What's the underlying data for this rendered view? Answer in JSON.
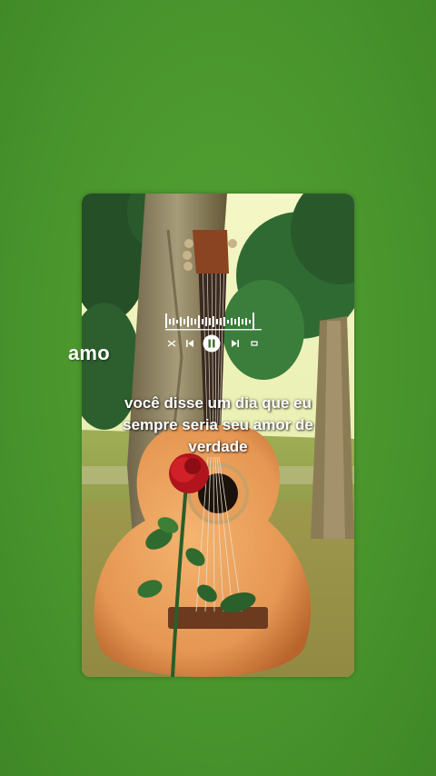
{
  "screen": {
    "background_color": "#4c972f"
  },
  "card": {
    "image_description_icon": "guitar-rose-photo"
  },
  "side_word": "amo",
  "player": {
    "controls": [
      {
        "name": "shuffle-icon",
        "glyph": "⤨"
      },
      {
        "name": "previous-icon",
        "glyph": "⏮"
      },
      {
        "name": "pause-icon",
        "glyph": "⏸"
      },
      {
        "name": "next-icon",
        "glyph": "⏭"
      },
      {
        "name": "repeat-icon",
        "glyph": "↻"
      }
    ]
  },
  "lyrics": {
    "line1": "você disse um dia que eu",
    "line2": "sempre seria seu amor de",
    "line3": "verdade"
  }
}
